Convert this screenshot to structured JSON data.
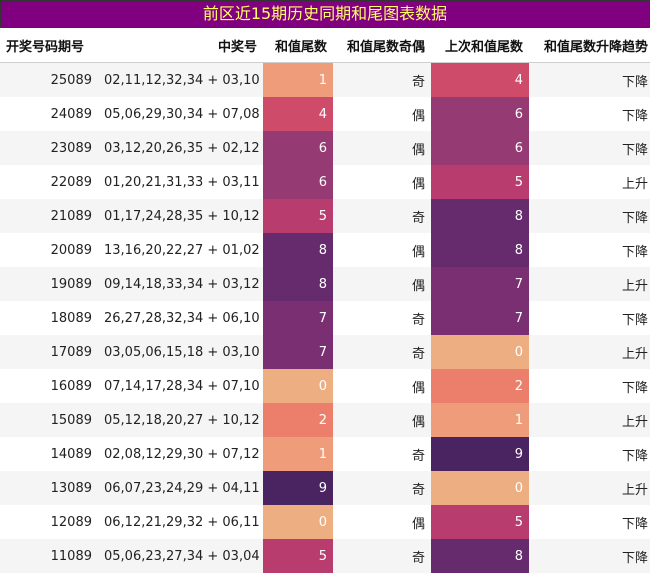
{
  "title": "前区近15期历史同期和尾图表数据",
  "headers": [
    "开奖号码期号",
    "中奖号",
    "和值尾数",
    "和值尾数奇偶",
    "上次和值尾数",
    "和值尾数升降趋势"
  ],
  "heat_colors": [
    "#edaf81",
    "#ee9c79",
    "#eb7f6b",
    "#e05e67",
    "#ce4b69",
    "#b93c6e",
    "#963a74",
    "#7a2f73",
    "#652b6c",
    "#4a2461"
  ],
  "rows": [
    {
      "period": "25089",
      "numbers": "02,11,12,32,34 + 03,10",
      "tail": 1,
      "parity": "奇",
      "prev_tail": 4,
      "trend": "下降"
    },
    {
      "period": "24089",
      "numbers": "05,06,29,30,34 + 07,08",
      "tail": 4,
      "parity": "偶",
      "prev_tail": 6,
      "trend": "下降"
    },
    {
      "period": "23089",
      "numbers": "03,12,20,26,35 + 02,12",
      "tail": 6,
      "parity": "偶",
      "prev_tail": 6,
      "trend": "下降"
    },
    {
      "period": "22089",
      "numbers": "01,20,21,31,33 + 03,11",
      "tail": 6,
      "parity": "偶",
      "prev_tail": 5,
      "trend": "上升"
    },
    {
      "period": "21089",
      "numbers": "01,17,24,28,35 + 10,12",
      "tail": 5,
      "parity": "奇",
      "prev_tail": 8,
      "trend": "下降"
    },
    {
      "period": "20089",
      "numbers": "13,16,20,22,27 + 01,02",
      "tail": 8,
      "parity": "偶",
      "prev_tail": 8,
      "trend": "下降"
    },
    {
      "period": "19089",
      "numbers": "09,14,18,33,34 + 03,12",
      "tail": 8,
      "parity": "偶",
      "prev_tail": 7,
      "trend": "上升"
    },
    {
      "period": "18089",
      "numbers": "26,27,28,32,34 + 06,10",
      "tail": 7,
      "parity": "奇",
      "prev_tail": 7,
      "trend": "下降"
    },
    {
      "period": "17089",
      "numbers": "03,05,06,15,18 + 03,10",
      "tail": 7,
      "parity": "奇",
      "prev_tail": 0,
      "trend": "上升"
    },
    {
      "period": "16089",
      "numbers": "07,14,17,28,34 + 07,10",
      "tail": 0,
      "parity": "偶",
      "prev_tail": 2,
      "trend": "下降"
    },
    {
      "period": "15089",
      "numbers": "05,12,18,20,27 + 10,12",
      "tail": 2,
      "parity": "偶",
      "prev_tail": 1,
      "trend": "上升"
    },
    {
      "period": "14089",
      "numbers": "02,08,12,29,30 + 07,12",
      "tail": 1,
      "parity": "奇",
      "prev_tail": 9,
      "trend": "下降"
    },
    {
      "period": "13089",
      "numbers": "06,07,23,24,29 + 04,11",
      "tail": 9,
      "parity": "奇",
      "prev_tail": 0,
      "trend": "上升"
    },
    {
      "period": "12089",
      "numbers": "06,12,21,29,32 + 06,11",
      "tail": 0,
      "parity": "偶",
      "prev_tail": 5,
      "trend": "下降"
    },
    {
      "period": "11089",
      "numbers": "05,06,23,27,34 + 03,04",
      "tail": 5,
      "parity": "奇",
      "prev_tail": 8,
      "trend": "下降"
    }
  ]
}
